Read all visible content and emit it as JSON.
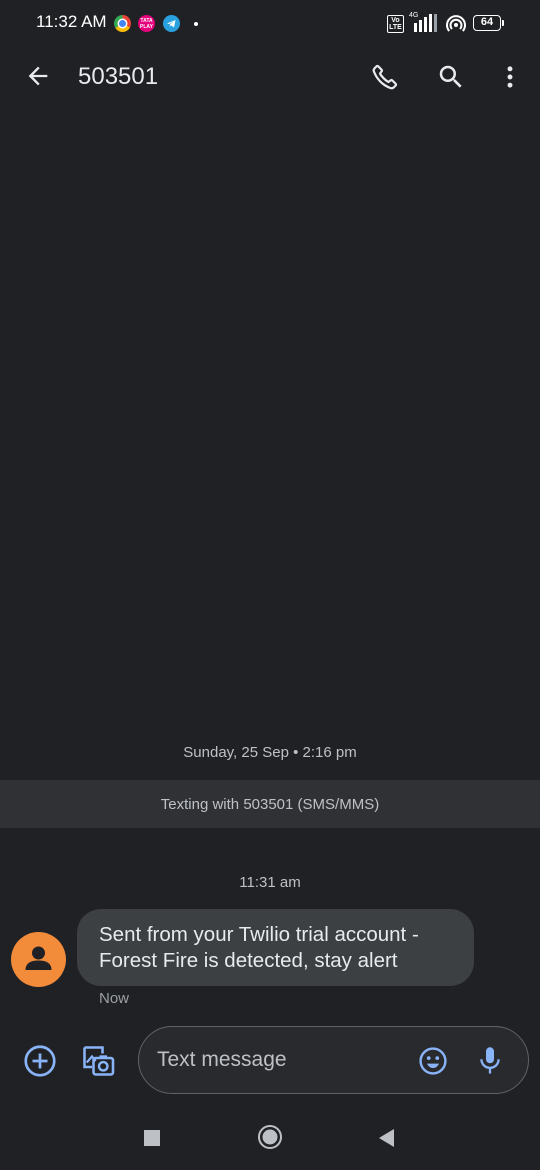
{
  "status_bar": {
    "time": "11:32 AM",
    "apps": [
      "chrome-icon",
      "tata-play-icon",
      "telegram-icon"
    ],
    "tata_play_label": "TATA PLAY",
    "volte": "Vo LTE",
    "network": "4G",
    "battery": "64"
  },
  "header": {
    "title": "503501",
    "icons": [
      "arrow-back-icon",
      "phone-icon",
      "search-icon",
      "more-vert-icon"
    ]
  },
  "conversation": {
    "date_divider": "Sunday, 25 Sep • 2:16 pm",
    "texting_banner": "Texting with 503501 (SMS/MMS)",
    "messages": [
      {
        "time": "11:31 am",
        "lines": [
          "Sent from your Twilio trial account -",
          "Forest Fire is detected, stay alert"
        ],
        "status": "Now"
      }
    ]
  },
  "compose": {
    "placeholder": "Text message",
    "value": "",
    "icons": [
      "add-circle-icon",
      "gallery-camera-icon",
      "emoji-icon",
      "mic-icon"
    ]
  },
  "nav_bar": {
    "icons": [
      "recents-square-icon",
      "home-circle-icon",
      "back-triangle-icon"
    ]
  },
  "colors": {
    "background": "#202124",
    "banner": "#303134",
    "bubble": "#3c4043",
    "accent": "#8ab4f8",
    "avatar": "#f28b3a"
  }
}
